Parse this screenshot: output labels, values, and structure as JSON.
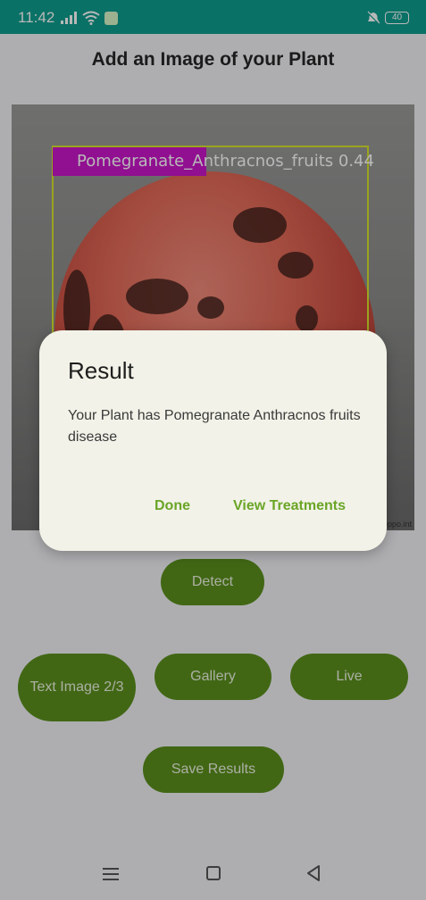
{
  "status_bar": {
    "time": "11:42",
    "battery": "40"
  },
  "page": {
    "title": "Add an Image of your Plant"
  },
  "image": {
    "detection_label": "Pomegranate_Anthracnos_fruits 0.44",
    "watermark": "oppo.int"
  },
  "buttons": {
    "detect": "Detect",
    "text_image": "Text Image 2/3",
    "gallery": "Gallery",
    "live": "Live",
    "save": "Save Results"
  },
  "dialog": {
    "title": "Result",
    "message": "Your Plant has Pomegranate Anthracnos fruits disease",
    "done_label": "Done",
    "view_treatments_label": "View Treatments"
  },
  "colors": {
    "status_bar": "#0e9d8e",
    "button": "#5a8f1d",
    "dialog_action": "#6aa526",
    "bbox": "#d7e22a",
    "label_bg": "#c915c9"
  }
}
